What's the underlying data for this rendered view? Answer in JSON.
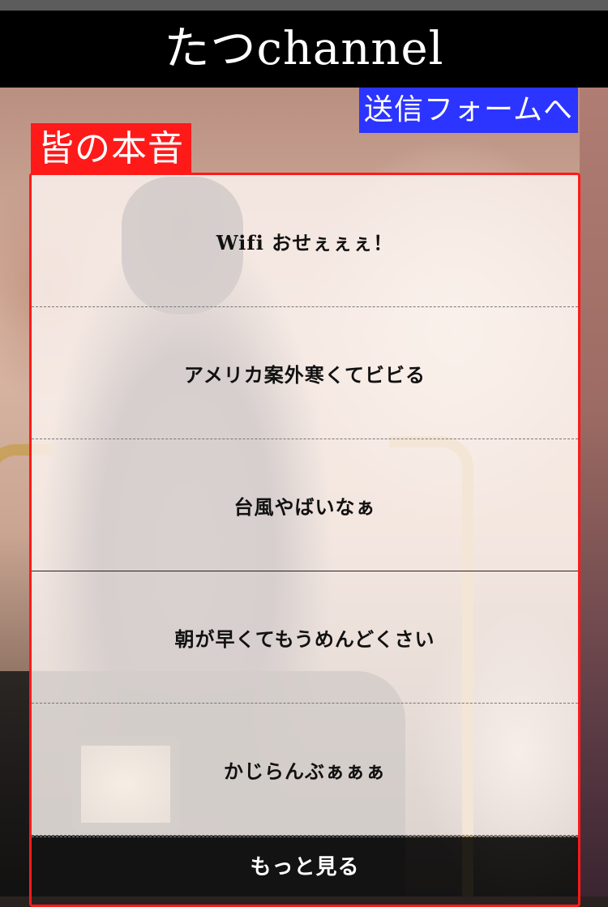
{
  "header": {
    "title": "たつchannel"
  },
  "actions": {
    "send_form_label": "送信フォームへ",
    "more_label": "もっと見る"
  },
  "section": {
    "label": "皆の本音"
  },
  "posts": [
    {
      "text": "Wifi おせぇぇぇ！"
    },
    {
      "text": "アメリカ案外寒くてビビる"
    },
    {
      "text": "台風やばいなぁ"
    },
    {
      "text": "朝が早くてもうめんどくさい"
    },
    {
      "text": "かじらんぶぁぁぁ"
    }
  ],
  "colors": {
    "header_bg": "#000000",
    "send_button_bg": "#2c34ff",
    "section_label_bg": "#ff1a1a",
    "panel_border": "#ff1a1a"
  }
}
